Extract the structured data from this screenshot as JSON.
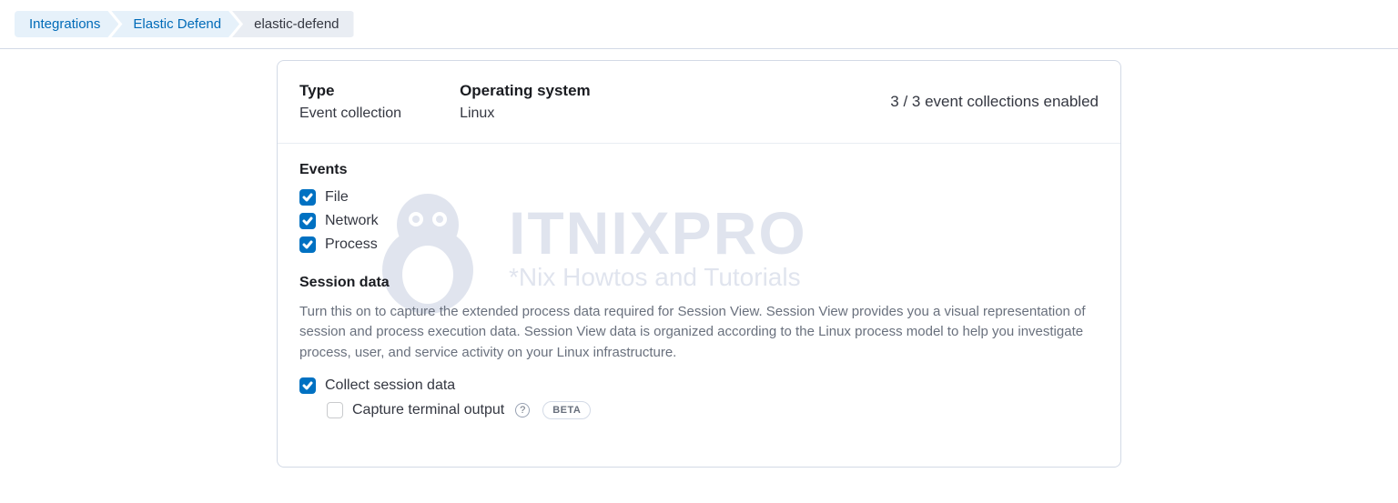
{
  "breadcrumb": {
    "items": [
      {
        "label": "Integrations",
        "link": true
      },
      {
        "label": "Elastic Defend",
        "link": true
      },
      {
        "label": "elastic-defend",
        "link": false
      }
    ]
  },
  "panel": {
    "header": {
      "type_label": "Type",
      "type_value": "Event collection",
      "os_label": "Operating system",
      "os_value": "Linux",
      "status": "3 / 3 event collections enabled"
    },
    "events": {
      "title": "Events",
      "items": [
        {
          "label": "File",
          "checked": true
        },
        {
          "label": "Network",
          "checked": true
        },
        {
          "label": "Process",
          "checked": true
        }
      ]
    },
    "session": {
      "title": "Session data",
      "description": "Turn this on to capture the extended process data required for Session View. Session View provides you a visual representation of session and process execution data. Session View data is organized according to the Linux process model to help you investigate process, user, and service activity on your Linux infrastructure.",
      "collect_label": "Collect session data",
      "collect_checked": true,
      "terminal_label": "Capture terminal output",
      "terminal_checked": false,
      "terminal_badge": "BETA"
    }
  },
  "watermark": {
    "title": "ITNIXPRO",
    "subtitle": "*Nix Howtos and Tutorials"
  }
}
